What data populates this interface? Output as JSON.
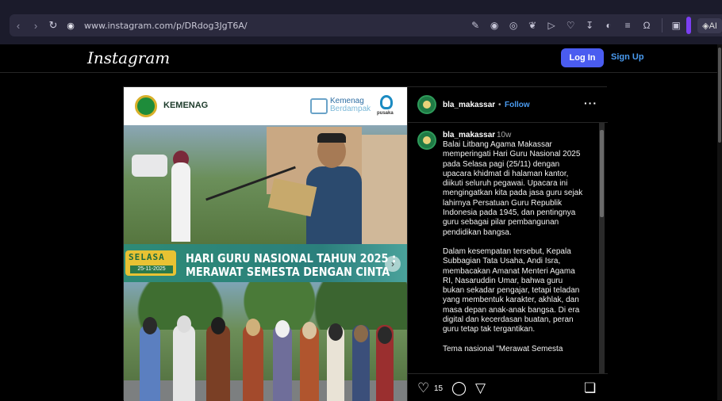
{
  "browser": {
    "url": "www.instagram.com/p/DRdog3JgT6A/",
    "back_icon": "back-arrow-icon",
    "forward_icon": "forward-arrow-icon",
    "reload_icon": "reload-icon",
    "ai_label": "AI"
  },
  "header": {
    "logo": "Instagram",
    "login_label": "Log In",
    "signup_label": "Sign Up",
    "login_color": "#4a5cf0",
    "signup_color": "#4a9bf0"
  },
  "post_image": {
    "org_name": "KEMENAG",
    "campaign_line1": "Kemenag",
    "campaign_line2": "Berdampak",
    "partner_name": "pusaka",
    "day_label": "SELASA",
    "date_label": "25-11-2025",
    "title_line1": "HARI GURU NASIONAL TAHUN 2025 :",
    "title_line2": "MERAWAT SEMESTA DENGAN CINTA"
  },
  "side": {
    "account_name": "bla_makassar",
    "dot": "•",
    "follow_label": "Follow",
    "more_icon": "···",
    "caption_user": "bla_makassar",
    "caption_time": "10w",
    "caption_p1": "Balai Litbang Agama Makassar\nmemperingati Hari Guru Nasional 2025\npada Selasa pagi (25/11) dengan\nupacara khidmat di halaman kantor,\ndiikuti seluruh pegawai. Upacara ini\nmengingatkan kita pada jasa guru sejak\nlahirnya Persatuan Guru Republik\nIndonesia pada 1945, dan pentingnya\nguru sebagai pilar pembangunan\npendidikan bangsa.",
    "caption_p2": "Dalam kesempatan tersebut, Kepala\nSubbagian Tata Usaha, Andi Isra,\nmembacakan Amanat Menteri Agama\nRI, Nasaruddin Umar, bahwa guru\nbukan sekadar pengajar, tetapi teladan\nyang membentuk karakter, akhlak, dan\nmasa depan anak-anak bangsa. Di era\ndigital dan kecerdasan buatan, peran\nguru tetap tak tergantikan.",
    "caption_p3": "Tema nasional \"Merawat Semesta",
    "like_count": "15"
  }
}
